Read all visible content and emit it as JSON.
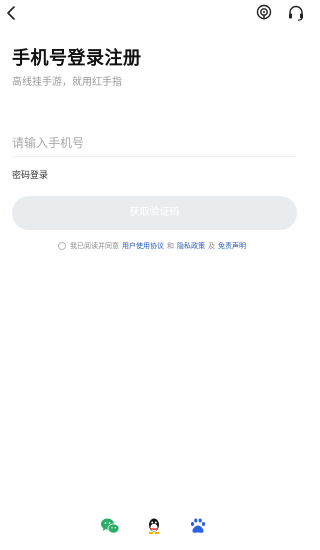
{
  "header": {
    "back_icon": "chevron-left-icon",
    "podcast_icon": "podcast-icon",
    "support_icon": "headset-icon"
  },
  "login": {
    "title": "手机号登录注册",
    "subtitle": "高线挂手游，就用红手指",
    "phone_placeholder": "请输入手机号",
    "phone_value": "",
    "password_login": "密码登录",
    "get_code_button": "获取验证码",
    "get_code_button_color": "#e9ecef"
  },
  "agreement": {
    "prefix": "我已阅读并同意",
    "user_agreement": "用户使用协议",
    "and": "和",
    "privacy_policy": "隐私政策",
    "and2": "及",
    "disclaimer": "免责声明",
    "link_color": "#2a5ab8"
  },
  "social": {
    "icons": [
      "wechat-icon",
      "qq-icon",
      "baidu-icon"
    ],
    "wechat_color": "#2aae67",
    "baidu_color": "#2b61e3"
  }
}
